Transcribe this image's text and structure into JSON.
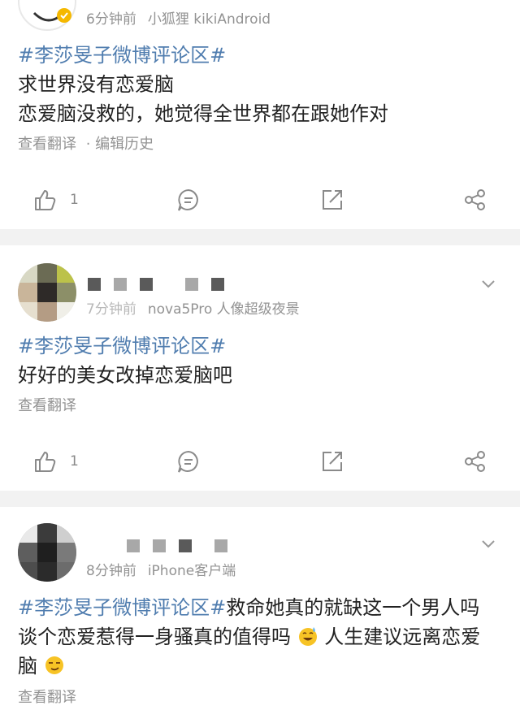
{
  "posts": [
    {
      "time": "6分钟前",
      "source": "小狐狸 kikiAndroid",
      "tag": "#李莎旻子微博评论区#",
      "lines": [
        "求世界没有恋爱脑",
        "恋爱脑没救的，她觉得全世界都在跟她作对"
      ],
      "translate_label": "查看翻译",
      "edit_label": "· 编辑历史",
      "like_count": "1"
    },
    {
      "time_obscured": "7分钟前",
      "source": "nova5Pro 人像超级夜景",
      "tag": "#李莎旻子微博评论区#",
      "lines": [
        "好好的美女改掉恋爱脑吧"
      ],
      "translate_label": "查看翻译",
      "like_count": "1"
    },
    {
      "time": "8分钟前",
      "source": "iPhone客户端",
      "tag": "#李莎旻子微博评论区#",
      "line1_rest": "救命她真的就缺这一个男人吗",
      "line2": "谈个恋爱惹得一身骚真的值得吗",
      "line2_rest": "人生建议远离恋爱",
      "line3": "脑",
      "translate_label": "查看翻译"
    }
  ],
  "icons": {
    "like": "thumbs-up-icon",
    "comment": "comment-bubble-icon",
    "repost": "repost-icon",
    "share": "share-icon",
    "more": "chevron-down-icon",
    "verified": "verified-badge-icon"
  },
  "colors": {
    "topic_link": "#507daf",
    "meta_text": "#939393",
    "separator": "#f2f2f2",
    "verified_badge": "#f5b800"
  }
}
